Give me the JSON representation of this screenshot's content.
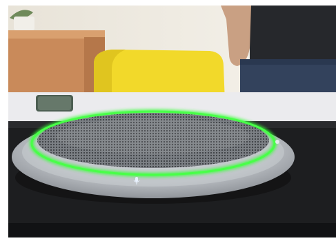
{
  "scene": {
    "subject": "speakerphone-on-table",
    "led_ring_color": "#3dff3d",
    "device_color": "#b9bdc2",
    "grille_color": "#7f8388",
    "chair_color": "#f1d82c",
    "cabinet_color": "#c8895a",
    "wall_color": "#f2eee6",
    "table_color": "#ececef",
    "base_color": "#202124",
    "icons": [
      "microphone-icon",
      "power-icon"
    ]
  }
}
